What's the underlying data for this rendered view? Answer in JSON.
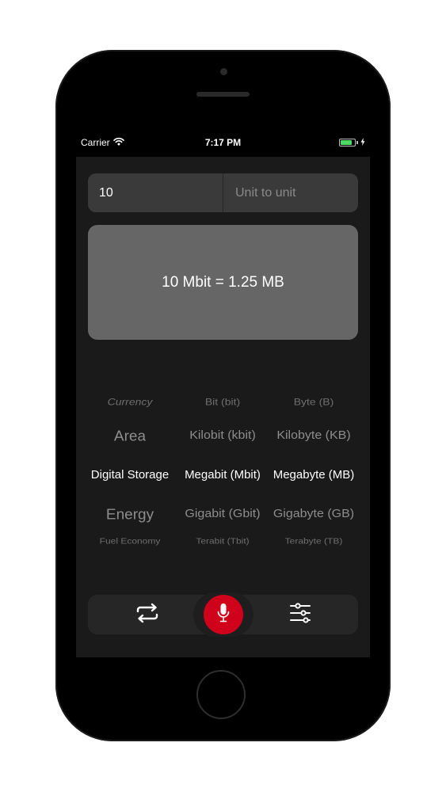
{
  "status_bar": {
    "carrier": "Carrier",
    "time": "7:17 PM",
    "battery_level": 0.8
  },
  "input": {
    "value": "10",
    "placeholder": "Unit to unit"
  },
  "result": {
    "text": "10 Mbit = 1.25 MB"
  },
  "picker": {
    "categories": [
      "Currency",
      "Area",
      "Digital Storage",
      "Energy",
      "Fuel Economy"
    ],
    "from_units": [
      "Bit (bit)",
      "Kilobit (kbit)",
      "Megabit (Mbit)",
      "Gigabit (Gbit)",
      "Terabit (Tbit)"
    ],
    "to_units": [
      "Byte (B)",
      "Kilobyte (KB)",
      "Megabyte (MB)",
      "Gigabyte (GB)",
      "Terabyte (TB)"
    ],
    "selected": {
      "category": "Digital Storage",
      "from_unit": "Megabit (Mbit)",
      "to_unit": "Megabyte (MB)"
    }
  },
  "toolbar": {
    "swap_icon": "swap-arrows-icon",
    "mic_icon": "microphone-icon",
    "settings_icon": "sliders-icon",
    "mic_color": "#d0021b"
  }
}
